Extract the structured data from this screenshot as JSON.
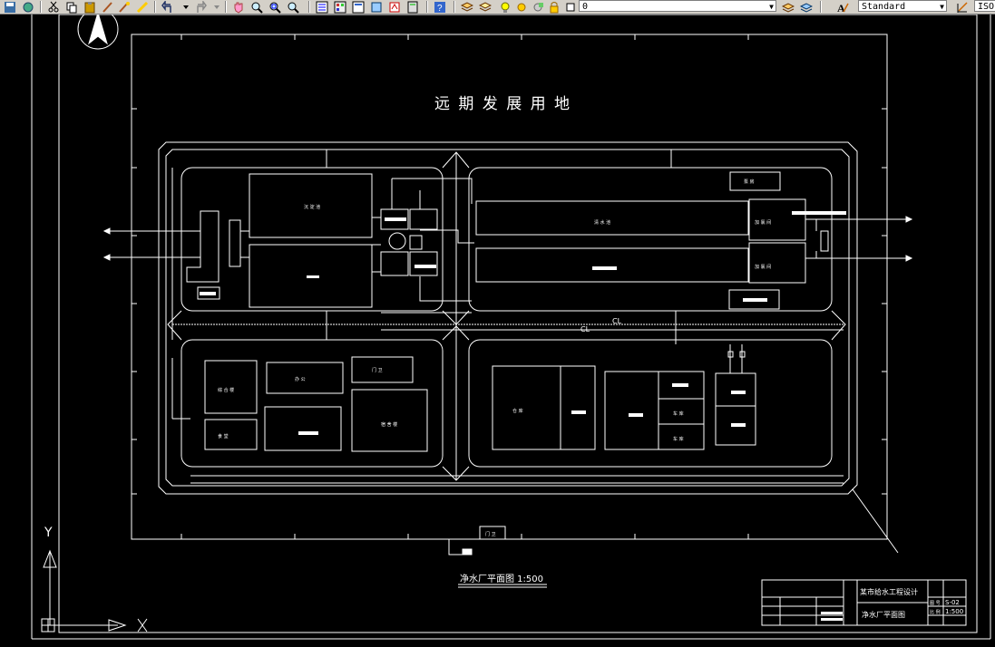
{
  "toolbar": {
    "buttons": [
      "help-icon",
      "layers-icon",
      "bulb-icon",
      "sun-icon",
      "lock-icon",
      "color-square-icon"
    ],
    "layer_value": "0",
    "textstyle_value": "Standard",
    "dim_value": "ISO"
  },
  "drawing": {
    "future_land_label": "远 期 发 展 用 地",
    "title_label": "净水厂平面图 1:500",
    "cl_label_1": "CL",
    "cl_label_2": "CL",
    "axis_y": "Y",
    "axis_x": "X",
    "titleblock": {
      "org": "某市给水工程设计",
      "drawing_name": "净水厂平面图",
      "sheet_no": "S-02",
      "scale": "1:500",
      "label_sheet": "图 号",
      "label_scale": "比 例"
    }
  }
}
